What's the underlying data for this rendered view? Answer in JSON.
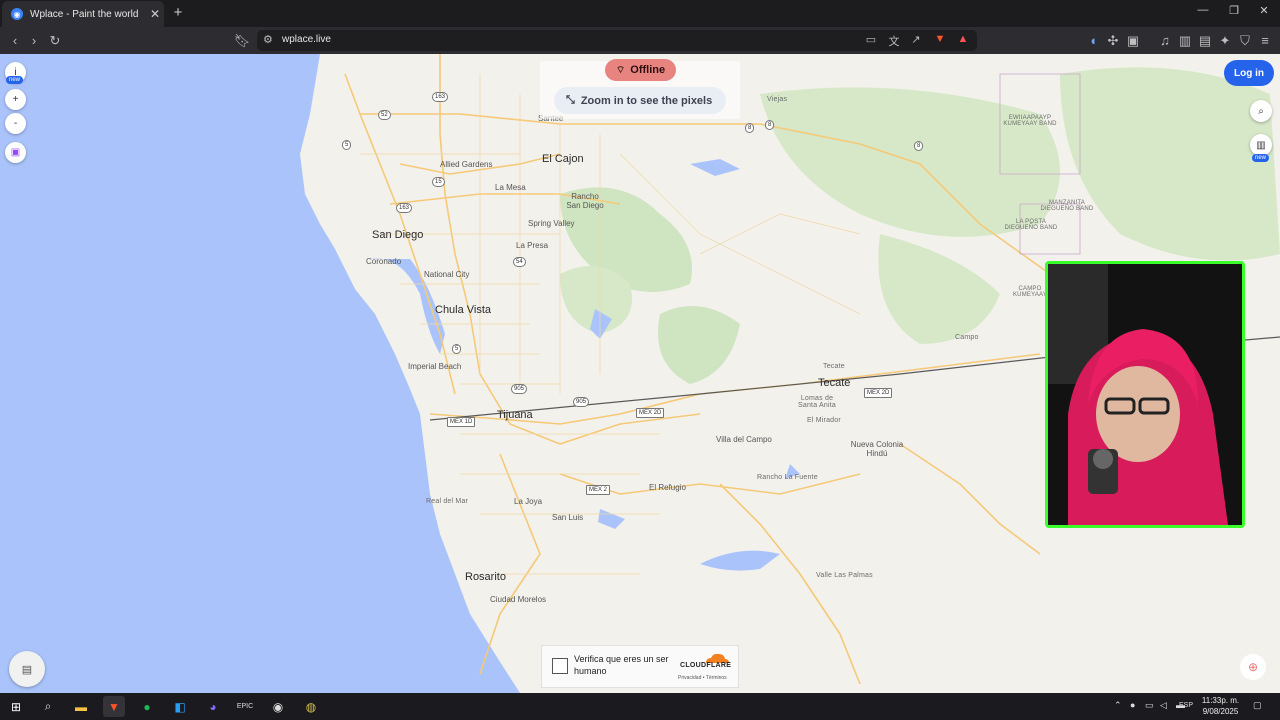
{
  "browser": {
    "tab_title": "Wplace - Paint the world",
    "tab_close": "✕",
    "new_tab": "+",
    "url": "wplace.live",
    "window_controls": {
      "minimize": "—",
      "restore": "❐",
      "close": "✕"
    }
  },
  "page": {
    "status": {
      "offline_label": "Offline",
      "zoom_hint": "Zoom in to see the pixels"
    },
    "login_label": "Log in",
    "left_controls": {
      "info": "i",
      "info_badge": "new",
      "zoom_in": "+",
      "zoom_out": "-"
    },
    "right_controls": {
      "badge": "new"
    },
    "map_labels": {
      "cities_big": [
        "San Diego",
        "El Cajon",
        "Chula Vista",
        "Tijuana",
        "Tecate",
        "Rosarito"
      ],
      "places": [
        "Santee",
        "Allied Gardens",
        "La Mesa",
        "Rancho San Diego",
        "Spring Valley",
        "La Presa",
        "Coronado",
        "National City",
        "Imperial Beach",
        "La Joya",
        "San Luis",
        "El Refugio",
        "Villa del Campo",
        "Lomas de Santa Anita",
        "El Mirador",
        "Nueva Colonia Hindú",
        "Rancho La Fuente",
        "Valle Las Palmas",
        "Ciudad Morelos",
        "Real del Mar",
        "Campo",
        "Viejas",
        "Tecate"
      ],
      "reservations": [
        "EWIIAAPAAYP KUMEYAAY BAND",
        "MANZANITA DIEGUEÑO BAND",
        "LA POSTA DIEGUEÑO BAND",
        "CAMPO KUMEYAAY"
      ],
      "shields": [
        "163",
        "52",
        "5",
        "15",
        "163",
        "54",
        "5",
        "905",
        "905",
        "8",
        "8",
        "8",
        "MEX 1D",
        "MEX 2D",
        "MEX 2D",
        "MEX 2"
      ]
    },
    "cloudflare": {
      "checkbox_text": "Verifica que eres un ser humano",
      "brand": "CLOUDFLARE",
      "privacy": "Privacidad",
      "terms": "Términos"
    }
  },
  "taskbar": {
    "lang": "ESP",
    "time": "11:33p. m.",
    "date": "9/08/2025"
  },
  "colors": {
    "water": "#aac4fb",
    "land": "#f3f1ec",
    "park": "#cfe5c1",
    "road": "#f5c977",
    "accent": "#2563eb",
    "offline": "#e8847f",
    "cam_border": "#3bff2a"
  }
}
